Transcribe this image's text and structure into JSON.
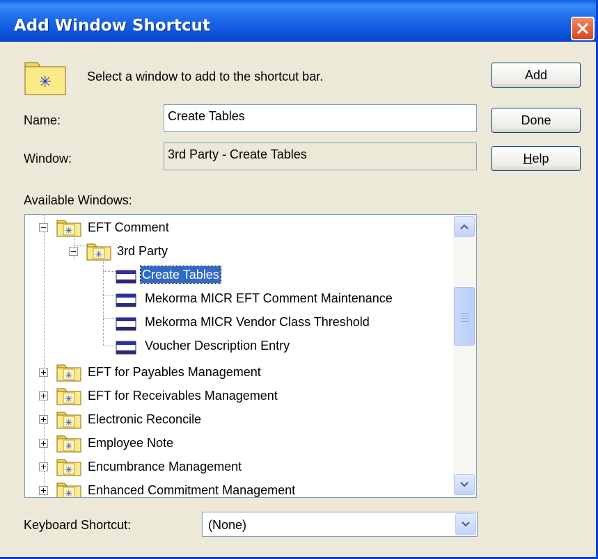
{
  "window": {
    "title": "Add Window Shortcut",
    "close_icon": "close-icon"
  },
  "instruction": "Select a window to add to the shortcut bar.",
  "name_field": {
    "label": "Name:",
    "value": "Create Tables"
  },
  "window_field": {
    "label": "Window:",
    "value": "3rd Party - Create Tables"
  },
  "buttons": {
    "add": "Add",
    "done": "Done",
    "help_underlined": "H",
    "help_rest": "elp"
  },
  "tree": {
    "label": "Available Windows:",
    "nodes": [
      {
        "label": "EFT Comment",
        "icon": "folder-icon",
        "expander": "collapse"
      },
      {
        "label": "3rd Party",
        "icon": "folder-icon",
        "expander": "collapse"
      },
      {
        "label": "Create Tables",
        "icon": "window-icon",
        "selected": true
      },
      {
        "label": "Mekorma MICR EFT Comment Maintenance",
        "icon": "window-icon"
      },
      {
        "label": "Mekorma MICR Vendor Class Threshold",
        "icon": "window-icon"
      },
      {
        "label": "Voucher Description Entry",
        "icon": "window-icon"
      },
      {
        "label": "EFT for Payables Management",
        "icon": "folder-icon",
        "expander": "expand"
      },
      {
        "label": "EFT for Receivables Management",
        "icon": "folder-icon",
        "expander": "expand"
      },
      {
        "label": "Electronic Reconcile",
        "icon": "folder-icon",
        "expander": "expand"
      },
      {
        "label": "Employee Note",
        "icon": "folder-icon",
        "expander": "expand"
      },
      {
        "label": "Encumbrance Management",
        "icon": "folder-icon",
        "expander": "expand"
      },
      {
        "label": "Enhanced Commitment Management",
        "icon": "folder-icon",
        "expander": "expand"
      }
    ]
  },
  "keyboard_shortcut": {
    "label": "Keyboard Shortcut:",
    "value": "(None)"
  },
  "colors": {
    "titlebar": "#0A4FD8",
    "dialog_bg": "#ECE9D8",
    "selection": "#316AC5",
    "close_button": "#D8431F"
  }
}
